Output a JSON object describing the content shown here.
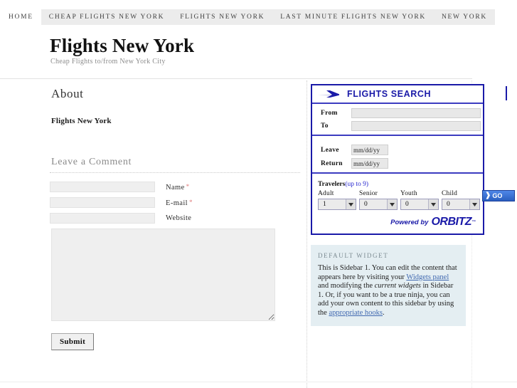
{
  "nav": {
    "items": [
      {
        "label": "Home",
        "shaded": false
      },
      {
        "label": "Cheap Flights New York",
        "shaded": true
      },
      {
        "label": "Flights New York",
        "shaded": true
      },
      {
        "label": "Last Minute Flights New York",
        "shaded": true
      },
      {
        "label": "New York",
        "shaded": true
      }
    ]
  },
  "header": {
    "title": "Flights New York",
    "tagline": "Cheap Flights to/from New York City"
  },
  "content": {
    "page_title": "About",
    "entry_text": "Flights New York",
    "comment_heading": "Leave a Comment",
    "fields": [
      {
        "label": "Name",
        "required": true,
        "value": "",
        "name": "name"
      },
      {
        "label": "E-mail",
        "required": true,
        "value": "",
        "name": "email"
      },
      {
        "label": "Website",
        "required": false,
        "value": "",
        "name": "website"
      }
    ],
    "comment_value": "",
    "submit_label": "Submit"
  },
  "flights_widget": {
    "title": "FLIGHTS SEARCH",
    "from_label": "From",
    "to_label": "To",
    "from_value": "",
    "to_value": "",
    "leave_label": "Leave",
    "return_label": "Return",
    "leave_value": "mm/dd/yy",
    "return_value": "mm/dd/yy",
    "travelers_label": "Travelers",
    "travelers_hint": "(up to 9)",
    "travelers": [
      {
        "label": "Adult",
        "value": "1"
      },
      {
        "label": "Senior",
        "value": "0"
      },
      {
        "label": "Youth",
        "value": "0"
      },
      {
        "label": "Child",
        "value": "0"
      }
    ],
    "search_button": "GO",
    "powered_by": "Powered by",
    "brand": "ORBITZ",
    "trademark": "™",
    "accent_color": "#1a1aa8"
  },
  "default_widget": {
    "title": "Default Widget",
    "text_1": "This is Sidebar 1. You can edit the content that appears here by visiting your ",
    "link_1": "Widgets panel",
    "text_2": " and modifying the ",
    "em_1": "current widgets",
    "text_3": " in Sidebar 1. Or, if you want to be a true ninja, you can add your own content to this sidebar by using the ",
    "link_2": "appropriate hooks",
    "text_4": "."
  }
}
